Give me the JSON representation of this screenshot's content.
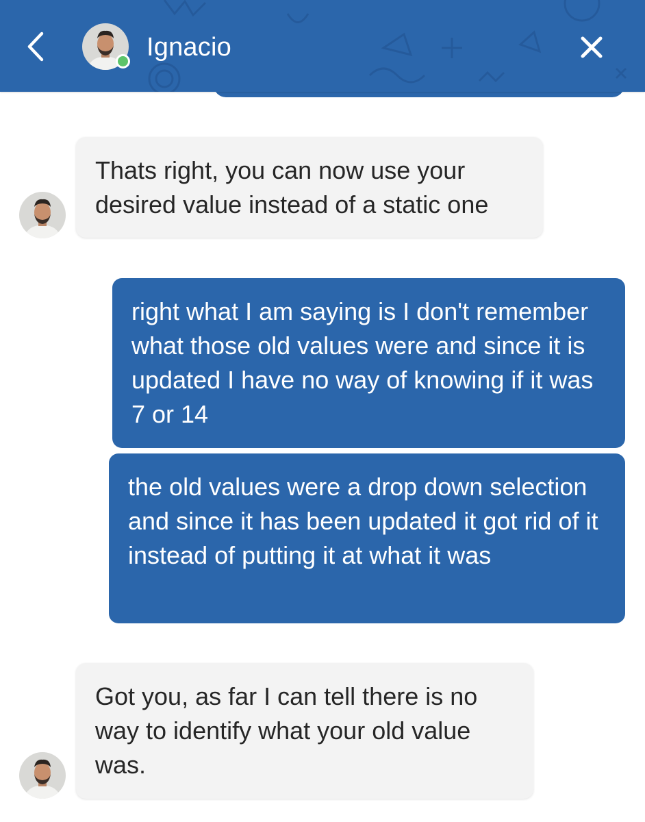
{
  "header": {
    "contact_name": "Ignacio",
    "back_icon": "chevron-left-icon",
    "close_icon": "close-icon",
    "status": "online",
    "colors": {
      "brand": "#2b66ab",
      "online": "#5cc46a"
    }
  },
  "messages": [
    {
      "direction": "incoming",
      "text": "Thats right, you can now use your desired value instead of a static one"
    },
    {
      "direction": "outgoing",
      "text": "right what I am saying is I don't remember what those old values were and since it is updated I have no way of knowing if it was 7 or 14"
    },
    {
      "direction": "outgoing",
      "text": "the old values were a drop down selection and since it has been updated it got rid of it instead of putting it at what it was"
    },
    {
      "direction": "incoming",
      "text": "Got you, as far I can tell there is no way to identify what your old value was."
    }
  ]
}
